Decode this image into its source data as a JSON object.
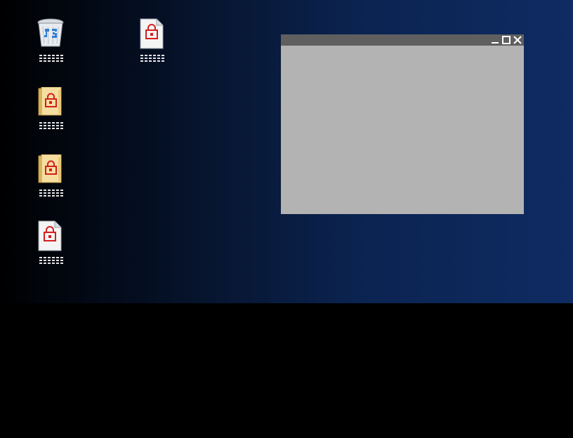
{
  "desktop": {
    "background_colors": [
      "#000000",
      "#0e2b62"
    ],
    "icons": [
      {
        "name": "recycle-bin",
        "icon": "recycle-bin-icon"
      },
      {
        "name": "locked-document",
        "icon": "locked-document-icon"
      },
      {
        "name": "locked-folder",
        "icon": "locked-folder-icon"
      },
      {
        "name": "locked-folder",
        "icon": "locked-folder-icon"
      },
      {
        "name": "locked-document",
        "icon": "locked-document-icon"
      }
    ]
  },
  "window": {
    "title": "",
    "titlebar_color": "#5f5f5f",
    "body_color": "#b3b3b3",
    "controls": [
      "minimize-icon",
      "maximize-icon",
      "close-icon"
    ]
  }
}
